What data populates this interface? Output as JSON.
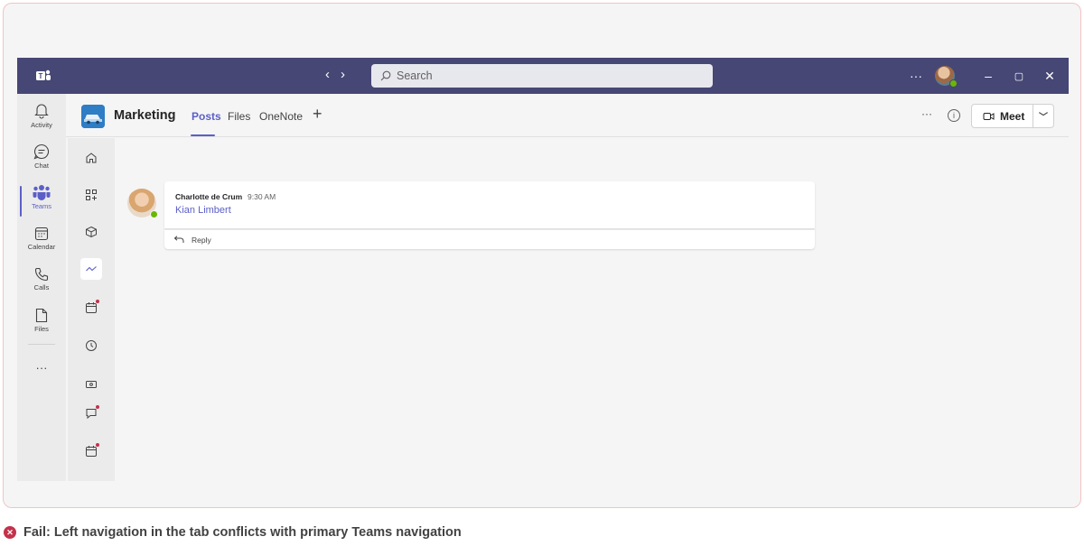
{
  "titlebar": {
    "search_placeholder": "Search",
    "nav_back": "‹",
    "nav_forward": "›",
    "more": "···",
    "minimize": "–",
    "maximize": "▢",
    "close": "✕"
  },
  "app_bar": {
    "items": [
      {
        "label": "Activity",
        "icon": "bell-icon"
      },
      {
        "label": "Chat",
        "icon": "chat-icon"
      },
      {
        "label": "Teams",
        "icon": "teams-icon",
        "active": true
      },
      {
        "label": "Calendar",
        "icon": "calendar-icon"
      },
      {
        "label": "Calls",
        "icon": "phone-icon"
      },
      {
        "label": "Files",
        "icon": "file-icon"
      }
    ],
    "more": "···"
  },
  "header": {
    "team_name": "Marketing",
    "tabs": [
      {
        "label": "Posts",
        "active": true
      },
      {
        "label": "Files"
      },
      {
        "label": "OneNote"
      }
    ],
    "add_tab": "+",
    "more": "···",
    "info": "i",
    "meet_label": "Meet"
  },
  "tab_nav": {
    "items": [
      "home-icon",
      "apps-icon",
      "cube-icon",
      "trend-icon",
      "calendar-alert-icon",
      "clock-icon",
      "money-icon",
      "comment-alert-icon",
      "calendar-alert-icon"
    ]
  },
  "post": {
    "author": "Charlotte de Crum",
    "time": "9:30 AM",
    "mention": "Kian Limbert",
    "reply_label": "Reply"
  },
  "caption": {
    "text": "Fail: Left navigation in the tab conflicts with primary Teams navigation"
  },
  "colors": {
    "titlebar": "#464775",
    "accent": "#5b5fc7",
    "fail": "#c4314b",
    "presence": "#6bb700"
  }
}
